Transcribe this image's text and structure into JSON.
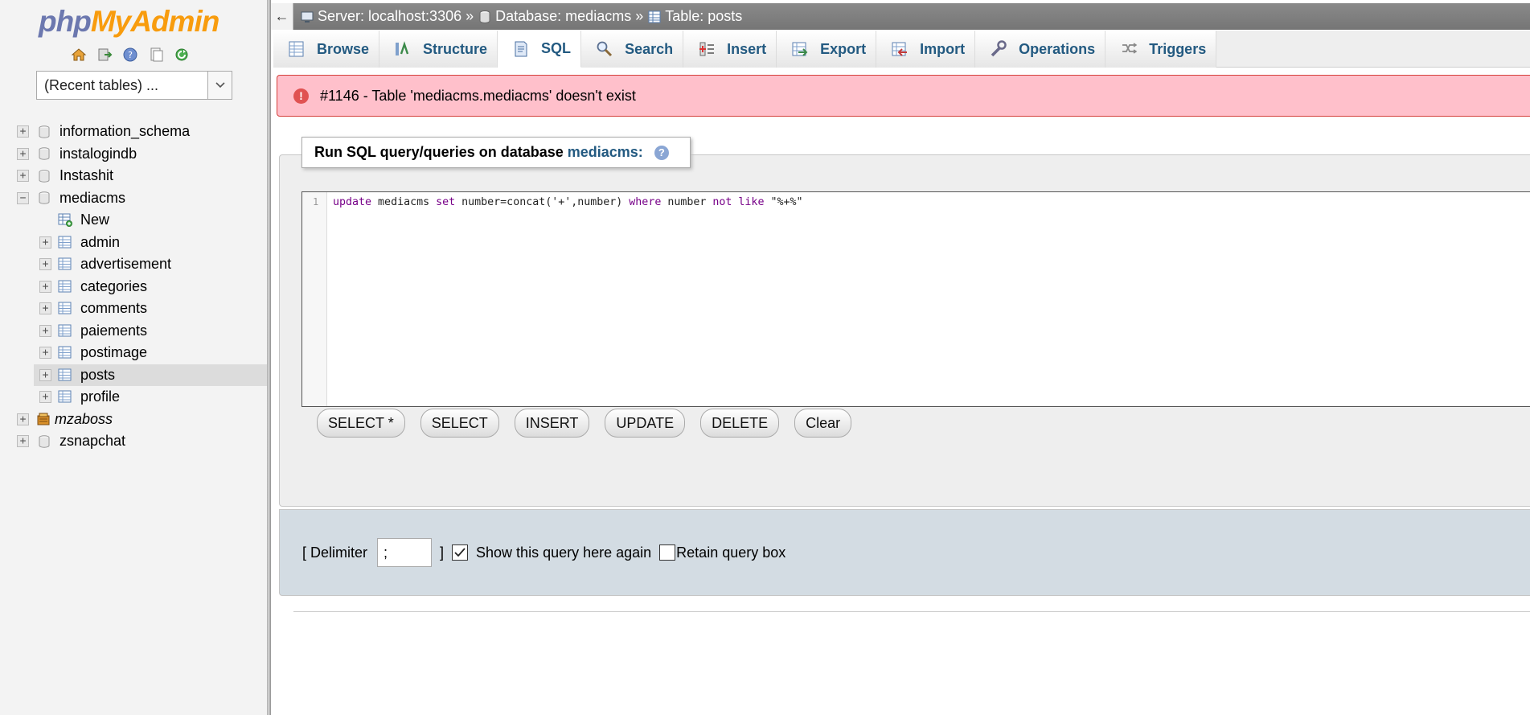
{
  "logo": {
    "php": "php",
    "my": "My",
    "admin": "Admin"
  },
  "sidebar": {
    "quick_icons": [
      "home-icon",
      "exit-icon",
      "help-icon",
      "docs-icon",
      "reload-icon"
    ],
    "recent_tables": "(Recent tables) ...",
    "tree": [
      {
        "label": "information_schema",
        "level": 0,
        "type": "db",
        "expander": "+"
      },
      {
        "label": "instalogindb",
        "level": 0,
        "type": "db",
        "expander": "+"
      },
      {
        "label": "Instashit",
        "level": 0,
        "type": "db",
        "expander": "+"
      },
      {
        "label": "mediacms",
        "level": 0,
        "type": "db",
        "expander": "−"
      },
      {
        "label": "New",
        "level": 1,
        "type": "new",
        "expander": ""
      },
      {
        "label": "admin",
        "level": 1,
        "type": "table",
        "expander": "+"
      },
      {
        "label": "advertisement",
        "level": 1,
        "type": "table",
        "expander": "+"
      },
      {
        "label": "categories",
        "level": 1,
        "type": "table",
        "expander": "+"
      },
      {
        "label": "comments",
        "level": 1,
        "type": "table",
        "expander": "+"
      },
      {
        "label": "paiements",
        "level": 1,
        "type": "table",
        "expander": "+"
      },
      {
        "label": "postimage",
        "level": 1,
        "type": "table",
        "expander": "+"
      },
      {
        "label": "posts",
        "level": 1,
        "type": "table",
        "expander": "+",
        "selected": true
      },
      {
        "label": "profile",
        "level": 1,
        "type": "table",
        "expander": "+"
      },
      {
        "label": "mzaboss",
        "level": 0,
        "type": "db-special",
        "expander": "+",
        "italic": true
      },
      {
        "label": "zsnapchat",
        "level": 0,
        "type": "db",
        "expander": "+"
      }
    ]
  },
  "breadcrumb": {
    "back": "←",
    "server": "Server: localhost:3306",
    "database": "Database: mediacms",
    "table": "Table: posts",
    "sep": "»"
  },
  "tabs": [
    {
      "label": "Browse",
      "icon": "browse-icon"
    },
    {
      "label": "Structure",
      "icon": "structure-icon"
    },
    {
      "label": "SQL",
      "icon": "sql-icon",
      "active": true
    },
    {
      "label": "Search",
      "icon": "search-icon"
    },
    {
      "label": "Insert",
      "icon": "insert-icon"
    },
    {
      "label": "Export",
      "icon": "export-icon"
    },
    {
      "label": "Import",
      "icon": "import-icon"
    },
    {
      "label": "Operations",
      "icon": "operations-icon"
    },
    {
      "label": "Triggers",
      "icon": "triggers-icon"
    }
  ],
  "error": {
    "message": "#1146 - Table 'mediacms.mediacms' doesn't exist"
  },
  "sql_panel": {
    "legend_prefix": "Run SQL query/queries on database",
    "legend_db": "mediacms:",
    "line_number": "1",
    "query_tokens": [
      {
        "t": "update",
        "kw": true
      },
      {
        "t": " mediacms ",
        "kw": false
      },
      {
        "t": "set",
        "kw": true
      },
      {
        "t": " number=concat('+',number) ",
        "kw": false
      },
      {
        "t": "where",
        "kw": true
      },
      {
        "t": " number ",
        "kw": false
      },
      {
        "t": "not",
        "kw": true
      },
      {
        "t": " ",
        "kw": false
      },
      {
        "t": "like",
        "kw": true
      },
      {
        "t": " \"%+%\"",
        "kw": false
      }
    ],
    "buttons": [
      "SELECT *",
      "SELECT",
      "INSERT",
      "UPDATE",
      "DELETE",
      "Clear"
    ]
  },
  "options": {
    "delimiter_label": "[ Delimiter",
    "delimiter_value": ";",
    "delimiter_close": "]",
    "show_query_label": "Show this query here again",
    "show_query_checked": true,
    "retain_label": "Retain query box",
    "retain_checked": false
  }
}
